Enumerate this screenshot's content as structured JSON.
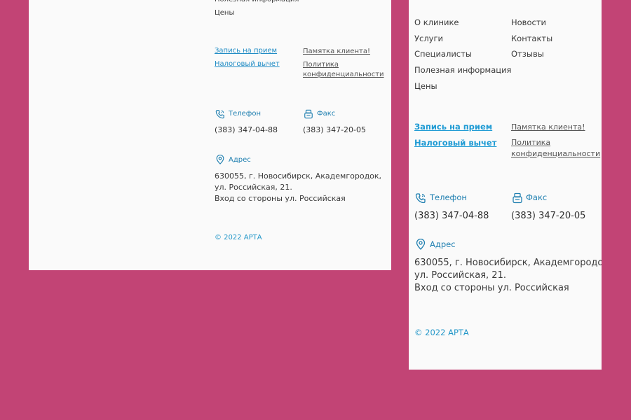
{
  "nav": {
    "about": "О клинике",
    "news": "Новости",
    "services": "Услуги",
    "contacts": "Контакты",
    "specialists": "Специалисты",
    "reviews": "Отзывы",
    "info": "Полезная информация",
    "prices": "Цены"
  },
  "links": {
    "appointment": "Запись на прием",
    "tax": "Налоговый вычет",
    "memo": "Памятка клиента!",
    "privacy_line1": "Политика",
    "privacy_line2": "конфиденциальности"
  },
  "contacts": {
    "phone_label": "Телефон",
    "phone_value": "(383) 347-04-88",
    "fax_label": "Факс",
    "fax_value": "(383) 347-20-05",
    "address_label": "Адрес",
    "address_line1": "630055, г. Новосибирск, Академгородок,",
    "address_line2": "ул. Российская, 21.",
    "address_line3": "Вход со стороны ул. Российская"
  },
  "copyright": "© 2022 АРТА",
  "colors": {
    "background": "#c24475",
    "panel": "#fafafa",
    "accent": "#1f9bd4"
  }
}
